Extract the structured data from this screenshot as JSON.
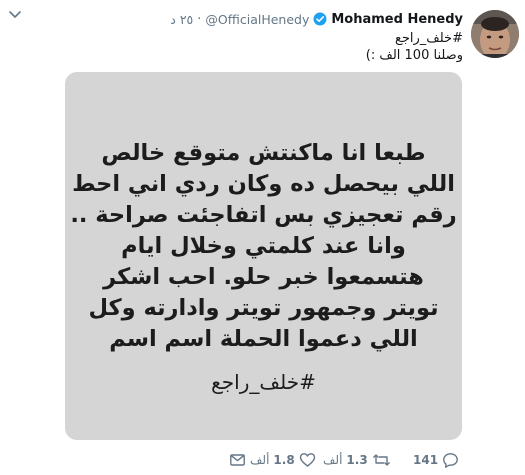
{
  "tweet": {
    "display_name": "Mohamed Henedy",
    "handle": "@OfficialHenedy",
    "separator": "·",
    "time": "٢٥ د",
    "text_lines": [
      "#خلف_راجع",
      "وصلنا 100 الف :)"
    ]
  },
  "media": {
    "lines": [
      "طبعا انا ماكنتش متوقع خالص",
      "اللي بيحصل ده وكان ردي اني احط",
      "رقم تعجيزي بس اتفاجئت صراحة ..",
      "وانا عند كلمتي وخلال ايام",
      "هتسمعوا خبر حلو. احب اشكر",
      "تويتر  وجمهور تويتر وادارته وكل",
      "اللي دعموا الحملة اسم اسم"
    ],
    "hashtag": "#خلف_راجع"
  },
  "actions": {
    "reply_count": "141",
    "retweet_count": "1.3",
    "retweet_unit": "ألف",
    "like_count": "1.8",
    "like_unit": "ألف"
  },
  "colors": {
    "accent_verified": "#1da1f2",
    "muted_text": "#657786",
    "media_background": "#d5d5d5"
  },
  "icons": [
    "chevron-down-icon",
    "verified-badge-icon",
    "reply-icon",
    "retweet-icon",
    "like-icon",
    "message-icon"
  ]
}
